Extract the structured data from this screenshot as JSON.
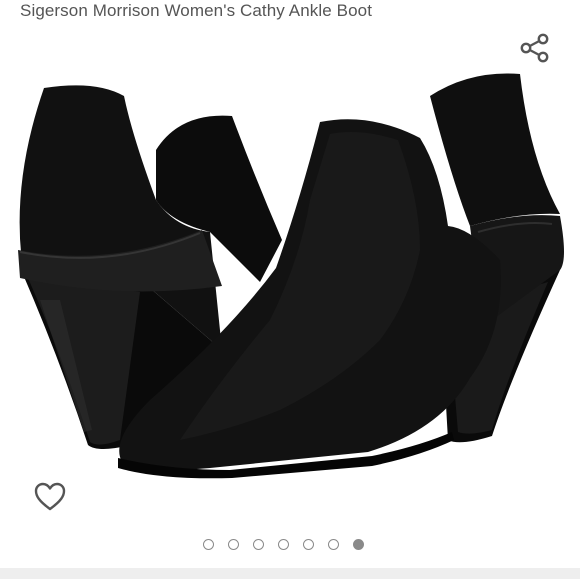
{
  "product": {
    "title": "Sigerson Morrison Women's Cathy Ankle Boot"
  },
  "icons": {
    "share": "share-icon",
    "wishlist": "heart-outline-icon"
  },
  "carousel": {
    "total_images": 7,
    "active_index": 7
  },
  "colors": {
    "title_text": "#555555",
    "icon": "#555555",
    "dot": "#8a8a8a",
    "bottom_bar": "#eeeeee"
  }
}
